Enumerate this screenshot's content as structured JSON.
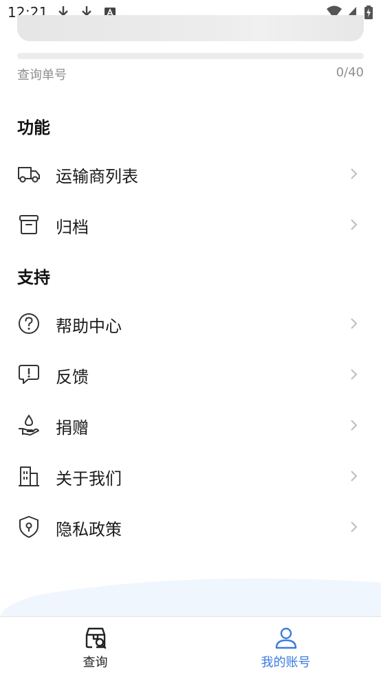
{
  "status_bar": {
    "time": "12:21",
    "left_icons": [
      "download-icon",
      "download-icon",
      "text-a-icon"
    ],
    "right_icons": [
      "wifi-icon",
      "signal-icon",
      "battery-charging-icon"
    ]
  },
  "search": {
    "hint": "查询单号",
    "counter": "0/40"
  },
  "sections": {
    "features_title": "功能",
    "support_title": "支持"
  },
  "features": [
    {
      "label": "运输商列表",
      "icon": "truck-icon"
    },
    {
      "label": "归档",
      "icon": "archive-icon"
    }
  ],
  "support": [
    {
      "label": "帮助中心",
      "icon": "help-circle-icon"
    },
    {
      "label": "反馈",
      "icon": "feedback-icon"
    },
    {
      "label": "捐赠",
      "icon": "donate-icon"
    },
    {
      "label": "关于我们",
      "icon": "building-icon"
    },
    {
      "label": "隐私政策",
      "icon": "shield-icon"
    }
  ],
  "bottom_nav": {
    "tabs": [
      {
        "label": "查询",
        "icon": "package-search-icon",
        "active": false
      },
      {
        "label": "我的账号",
        "icon": "user-icon",
        "active": true
      }
    ]
  },
  "colors": {
    "accent": "#3A7BE0",
    "text": "#1B1B1B",
    "muted": "#8E8E8E",
    "chevron": "#BDBDBD"
  }
}
